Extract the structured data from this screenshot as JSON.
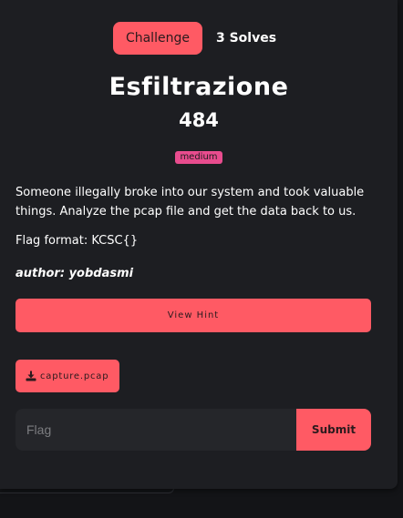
{
  "tabs": {
    "challenge_label": "Challenge",
    "solves_label": "3 Solves"
  },
  "challenge": {
    "name": "Esfiltrazione",
    "points": "484",
    "difficulty": "medium",
    "description": "Someone illegally broke into our system and took valuable things. Analyze the pcap file and get the data back to us.",
    "flag_format": "Flag format: KCSC{}",
    "author": "author: yobdasmi"
  },
  "hint": {
    "label": "View Hint"
  },
  "files": [
    {
      "name": "capture.pcap",
      "icon": "download-icon"
    }
  ],
  "flag_form": {
    "placeholder": "Flag",
    "value": "",
    "submit_label": "Submit"
  },
  "colors": {
    "accent": "#ff5a64",
    "badge": "#e84c8e",
    "modal_bg": "#1d1e22",
    "page_bg": "#131417",
    "input_bg": "#25262a"
  }
}
